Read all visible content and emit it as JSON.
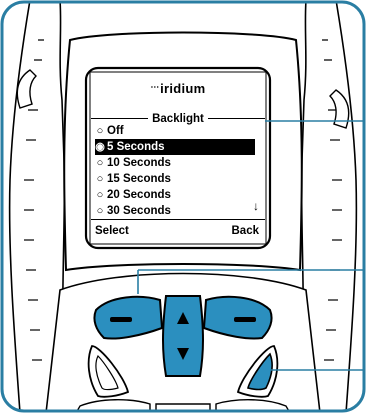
{
  "brand": {
    "logo_dots": "⋅⋅⋅",
    "name": "iridium"
  },
  "screen": {
    "title": "Backlight",
    "options": [
      {
        "label": "Off",
        "selected": false
      },
      {
        "label": "5 Seconds",
        "selected": true
      },
      {
        "label": "10 Seconds",
        "selected": false
      },
      {
        "label": "15 Seconds",
        "selected": false
      },
      {
        "label": "20 Seconds",
        "selected": false
      },
      {
        "label": "30 Seconds",
        "selected": false
      }
    ],
    "scroll_indicator": "↓",
    "left_softkey": "Select",
    "right_softkey": "Back"
  },
  "icons": {
    "radio_on": "◉",
    "radio_off": "○",
    "nav_up": "up-arrow-icon",
    "nav_down": "down-arrow-icon",
    "scroll": "down-arrow-icon"
  },
  "colors": {
    "frame_border": "#2a7ea3",
    "key_blue": "#2b8fbf",
    "callout_line": "#2a7ea3",
    "phone_body": "#ffffff",
    "outline": "#000000"
  }
}
